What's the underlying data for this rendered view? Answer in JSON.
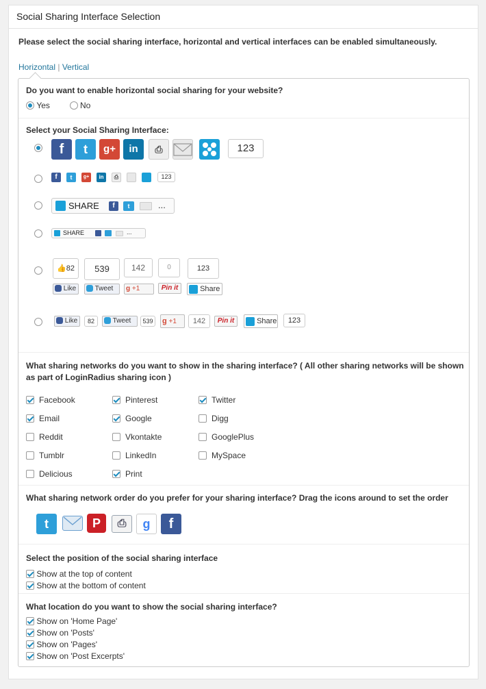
{
  "panel_title": "Social Sharing Interface Selection",
  "intro": "Please select the social sharing interface, horizontal and vertical interfaces can be enabled simultaneously.",
  "tabs": {
    "horizontal": "Horizontal",
    "sep": "|",
    "vertical": "Vertical"
  },
  "enable": {
    "question": "Do you want to enable horizontal social sharing for your website?",
    "yes": "Yes",
    "no": "No",
    "selected": "Yes"
  },
  "interface": {
    "question": "Select your Social Sharing Interface:",
    "selected_index": 0,
    "count_large": "123",
    "count_small": "123",
    "share_label": "SHARE",
    "more": "...",
    "fb_glyph": "f",
    "tw_glyph": "t",
    "gp_glyph": "g+",
    "li_glyph": "in",
    "counter_style": {
      "like": "Like",
      "like_count": "82",
      "tweet": "Tweet",
      "tweet_count": "539",
      "plus": "+1",
      "plus_count": "142",
      "pin": "Pin it",
      "pin_count": "0",
      "share": "Share",
      "share_count": "123"
    }
  },
  "networks": {
    "question": "What sharing networks do you want to show in the sharing interface? ( All other sharing networks will be shown as part of LoginRadius sharing icon )",
    "items": [
      {
        "label": "Facebook",
        "checked": true
      },
      {
        "label": "Pinterest",
        "checked": true
      },
      {
        "label": "Twitter",
        "checked": true
      },
      {
        "label": "Email",
        "checked": true
      },
      {
        "label": "Google",
        "checked": true
      },
      {
        "label": "Digg",
        "checked": false
      },
      {
        "label": "Reddit",
        "checked": false
      },
      {
        "label": "Vkontakte",
        "checked": false
      },
      {
        "label": "GooglePlus",
        "checked": false
      },
      {
        "label": "Tumblr",
        "checked": false
      },
      {
        "label": "LinkedIn",
        "checked": false
      },
      {
        "label": "MySpace",
        "checked": false
      },
      {
        "label": "Delicious",
        "checked": false
      },
      {
        "label": "Print",
        "checked": true
      }
    ]
  },
  "order": {
    "question": "What sharing network order do you prefer for your sharing interface? Drag the icons around to set the order",
    "icons": [
      "twitter-icon",
      "email-icon",
      "pinterest-icon",
      "print-icon",
      "google-icon",
      "facebook-icon"
    ]
  },
  "position": {
    "question": "Select the position of the social sharing interface",
    "options": [
      {
        "label": "Show at the top of content",
        "checked": true
      },
      {
        "label": "Show at the bottom of content",
        "checked": true
      }
    ]
  },
  "location": {
    "question": "What location do you want to show the social sharing interface?",
    "options": [
      {
        "label": "Show on 'Home Page'",
        "checked": true
      },
      {
        "label": "Show on 'Posts'",
        "checked": true
      },
      {
        "label": "Show on 'Pages'",
        "checked": true
      },
      {
        "label": "Show on 'Post Excerpts'",
        "checked": true
      }
    ]
  },
  "colors": {
    "link": "#21759b",
    "radio_accent": "#1e8cbe",
    "facebook": "#3b5998",
    "twitter": "#2e9fd9",
    "google": "#d34836",
    "linkedin": "#0e76a8",
    "pinterest": "#cb2027",
    "loginradius": "#1aa0d8"
  }
}
